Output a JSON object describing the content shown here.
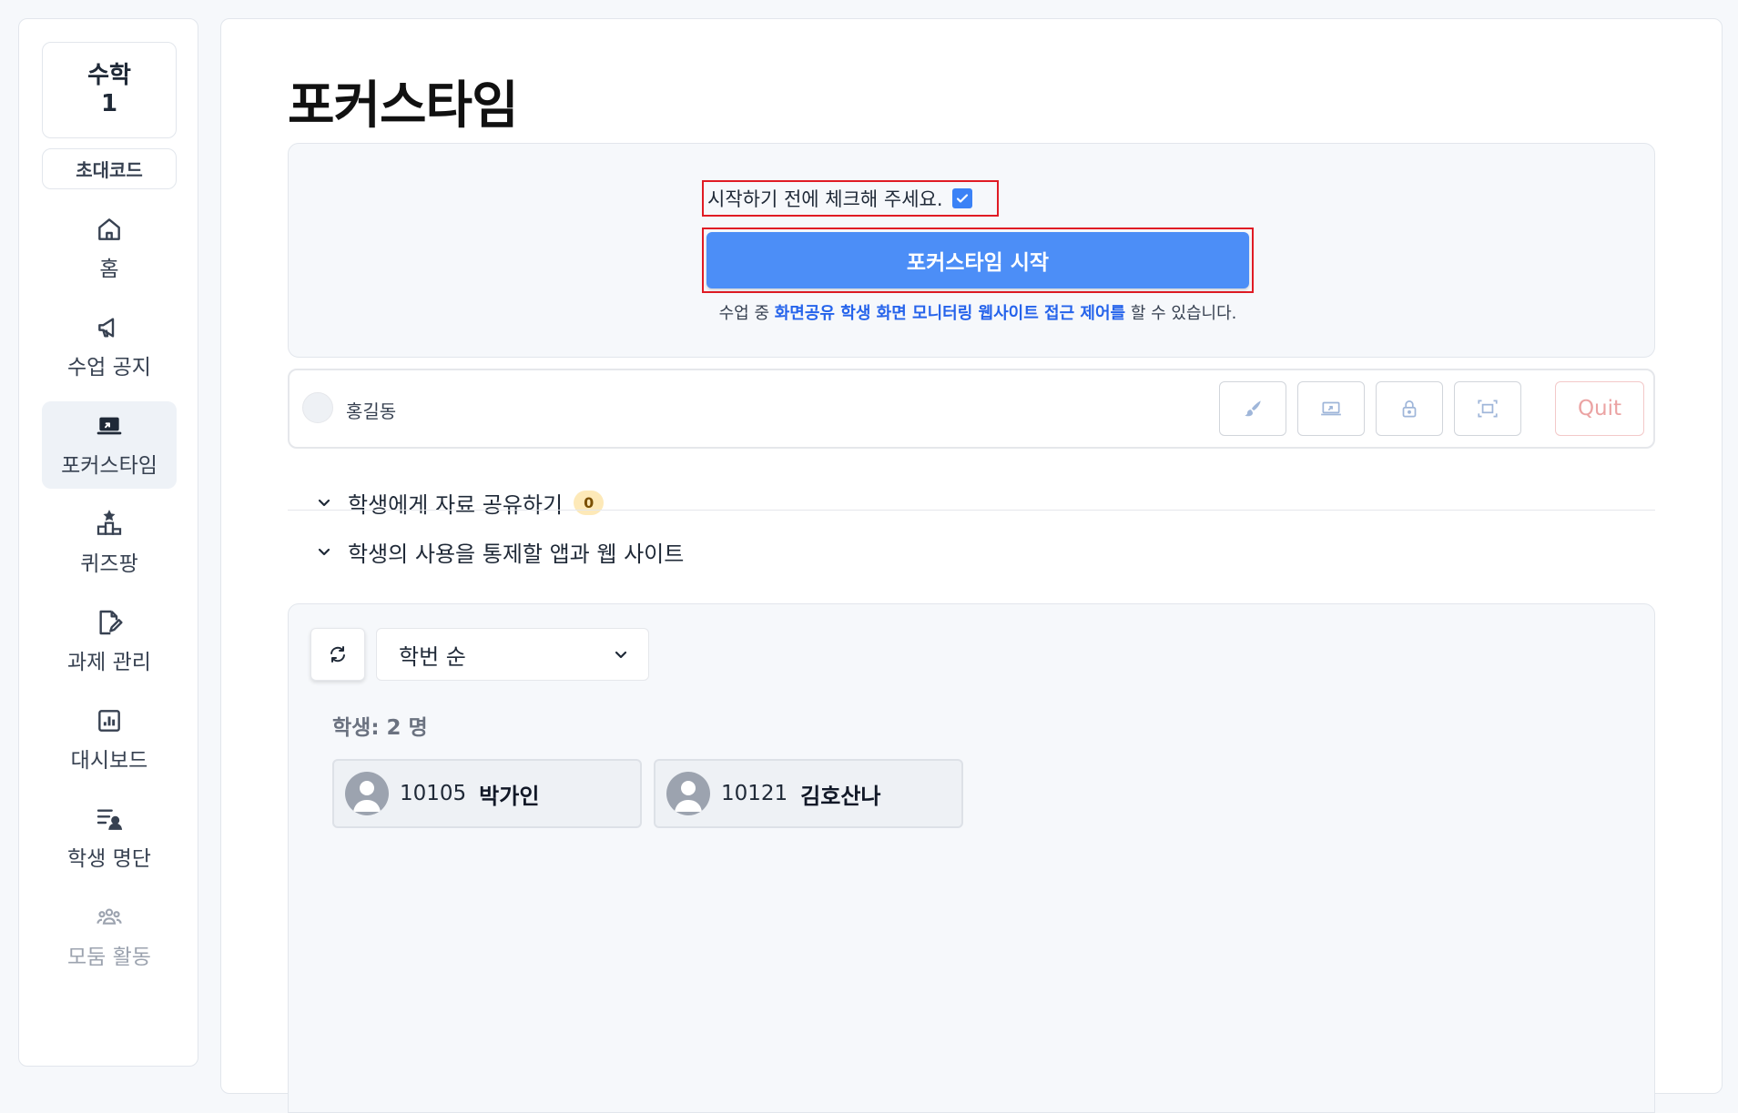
{
  "sidebar": {
    "class_name": "수학",
    "class_number": "1",
    "invite_code_label": "초대코드",
    "items": [
      {
        "label": "홈",
        "icon": "home-icon"
      },
      {
        "label": "수업 공지",
        "icon": "megaphone-icon"
      },
      {
        "label": "포커스타임",
        "icon": "laptop-icon",
        "active": true
      },
      {
        "label": "퀴즈팡",
        "icon": "podium-icon"
      },
      {
        "label": "과제 관리",
        "icon": "edit-document-icon"
      },
      {
        "label": "대시보드",
        "icon": "chart-icon"
      },
      {
        "label": "학생 명단",
        "icon": "roster-icon"
      },
      {
        "label": "모둠 활동",
        "icon": "group-icon",
        "disabled": true
      }
    ]
  },
  "page": {
    "title": "포커스타임"
  },
  "start_panel": {
    "check_label": "시작하기 전에 체크해 주세요.",
    "checked": true,
    "start_button": "포커스타임 시작",
    "hint_prefix": "수업 중 ",
    "hint_highlight": "화면공유 학생 화면 모니터링 웹사이트 접근 제어를",
    "hint_suffix": " 할 수 있습니다."
  },
  "teacher_bar": {
    "name": "홍길동",
    "tools": [
      "brush-icon",
      "screen-share-icon",
      "lock-icon",
      "fullscreen-icon"
    ],
    "quit_label": "Quit"
  },
  "accordions": [
    {
      "label": "학생에게 자료 공유하기",
      "badge": "0"
    },
    {
      "label": "학생의 사용을 통제할 앱과 웹 사이트"
    }
  ],
  "students": {
    "sort_selected": "학번 순",
    "count_label": "학생: 2 명",
    "list": [
      {
        "number": "10105",
        "name": "박가인"
      },
      {
        "number": "10121",
        "name": "김호산나"
      }
    ]
  },
  "colors": {
    "accent": "#4c8ef7",
    "highlight_text": "#2563eb",
    "annotation_border": "#e01b24",
    "quit_text": "#eba3a3",
    "badge_bg": "#fde9b8"
  }
}
